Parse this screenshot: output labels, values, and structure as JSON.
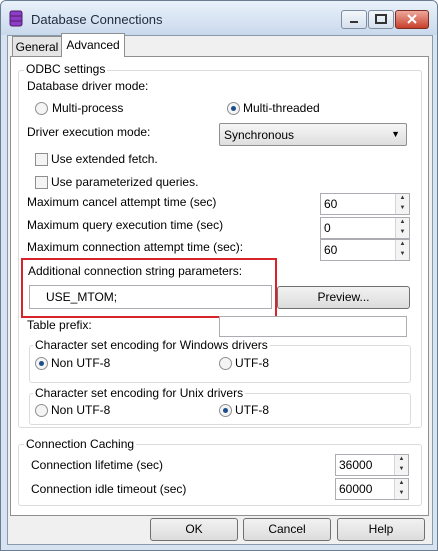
{
  "window": {
    "title": "Database Connections",
    "app_icon": "database-icon"
  },
  "tabs": [
    "General",
    "Advanced"
  ],
  "odbc": {
    "title": "ODBC settings",
    "driver_mode_label": "Database driver mode:",
    "driver_mode_options": [
      "Multi-process",
      "Multi-threaded"
    ],
    "driver_mode_selected": "Multi-threaded",
    "execution_mode_label": "Driver execution mode:",
    "execution_mode_value": "Synchronous",
    "extended_fetch_label": "Use extended fetch.",
    "extended_fetch_checked": false,
    "parameterized_label": "Use parameterized queries.",
    "parameterized_checked": false,
    "max_cancel_label": "Maximum cancel attempt time (sec)",
    "max_cancel_value": "60",
    "max_query_label": "Maximum query execution time (sec)",
    "max_query_value": "0",
    "max_conn_label": "Maximum connection attempt time (sec):",
    "max_conn_value": "60",
    "additional_label": "Additional connection string parameters:",
    "additional_value": "USE_MTOM;",
    "preview_label": "Preview...",
    "table_prefix_label": "Table prefix:",
    "table_prefix_value": ""
  },
  "windows_encoding": {
    "title": "Character set encoding for Windows drivers",
    "options": [
      "Non UTF-8",
      "UTF-8"
    ],
    "selected": "Non UTF-8"
  },
  "unix_encoding": {
    "title": "Character set encoding for Unix drivers",
    "options": [
      "Non UTF-8",
      "UTF-8"
    ],
    "selected": "UTF-8"
  },
  "caching": {
    "title": "Connection Caching",
    "lifetime_label": "Connection lifetime (sec)",
    "lifetime_value": "36000",
    "idle_label": "Connection idle timeout (sec)",
    "idle_value": "60000"
  },
  "footer": {
    "ok": "OK",
    "cancel": "Cancel",
    "help": "Help"
  }
}
